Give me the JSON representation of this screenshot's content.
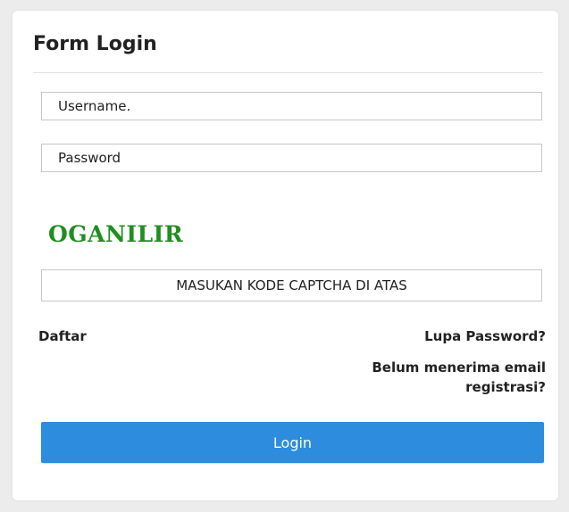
{
  "form": {
    "title": "Form Login",
    "username_value": "Username.",
    "password_value": "Password",
    "captcha_text": "OGANILIR",
    "captcha_input_value": "MASUKAN KODE CAPTCHA DI ATAS"
  },
  "links": {
    "register": "Daftar",
    "forgot_password": "Lupa Password?",
    "resend_email": "Belum menerima email registrasi?"
  },
  "buttons": {
    "login": "Login"
  },
  "colors": {
    "accent": "#2d8cde",
    "captcha": "#1f8f1f"
  }
}
